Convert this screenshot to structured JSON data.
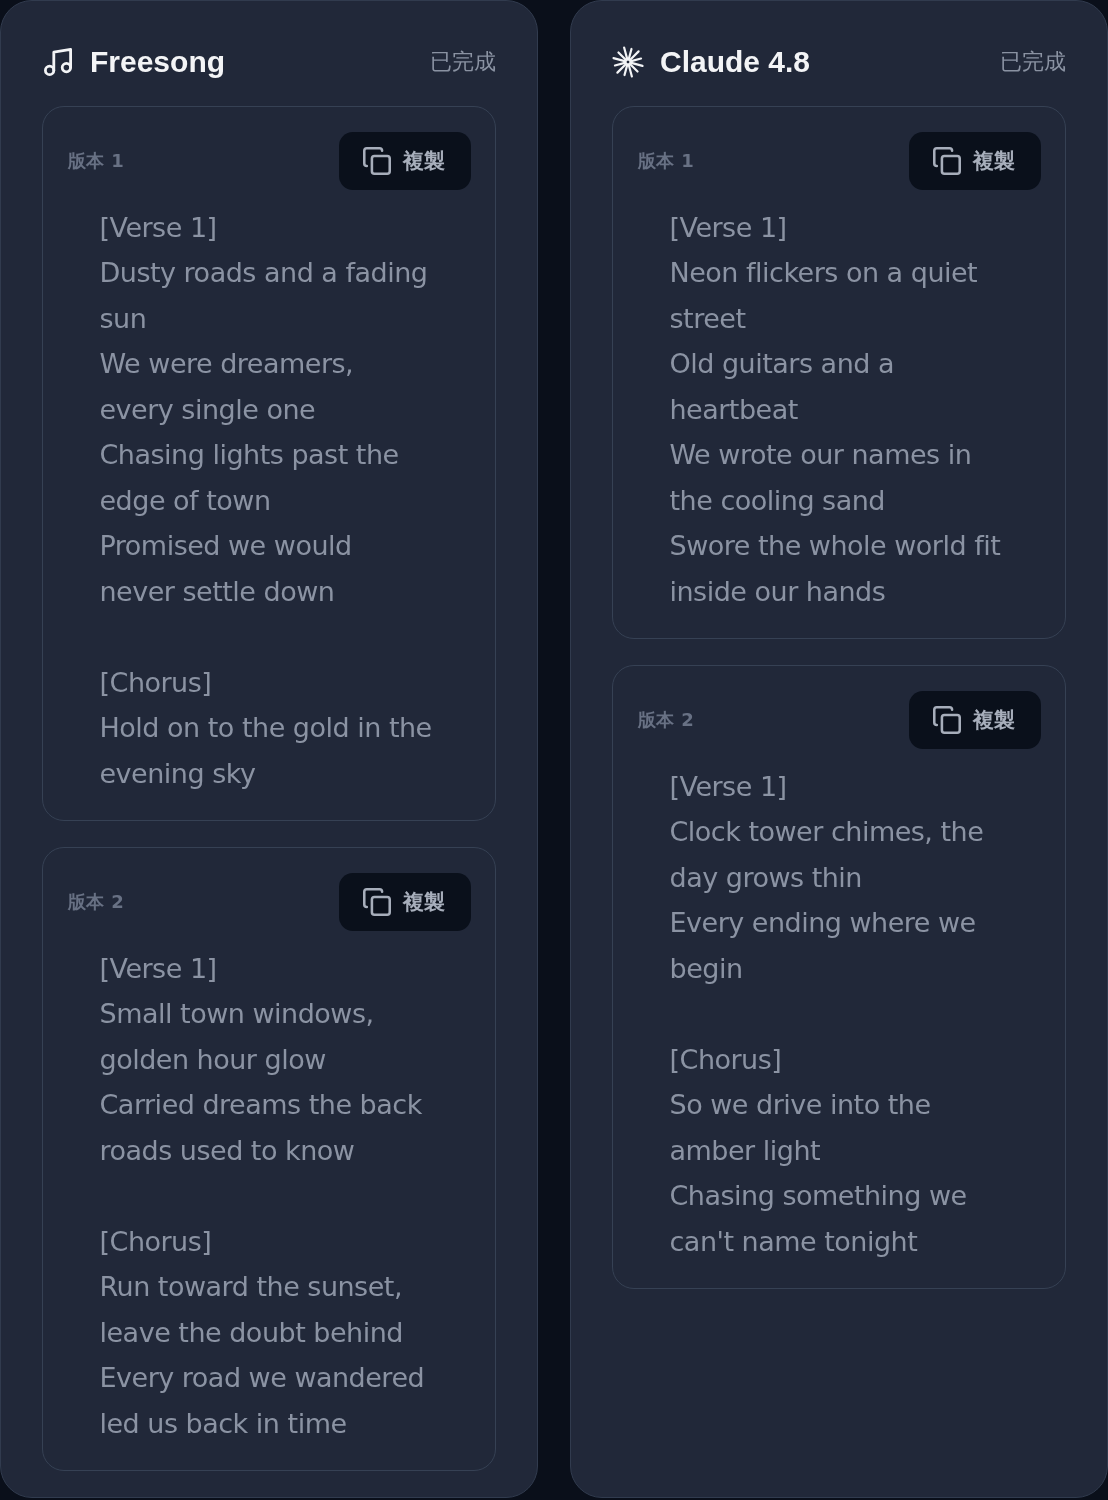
{
  "panels": [
    {
      "title": "Freesong",
      "status": "已完成",
      "versions": [
        {
          "label": "版本 1",
          "copy_button": "複製",
          "stanzas": [
            [
              "[Verse 1]",
              "Dusty roads and a fading sun",
              "We were dreamers, every single one",
              "Chasing lights past the edge of town",
              "Promised we would never settle down"
            ],
            [
              "[Chorus]",
              "Hold on to the gold in the evening sky"
            ]
          ]
        },
        {
          "label": "版本 2",
          "copy_button": "複製",
          "stanzas": [
            [
              "[Verse 1]",
              "Small town windows, golden hour glow",
              "Carried dreams the back roads used to know"
            ],
            [
              "[Chorus]",
              "Run toward the sunset, leave the doubt behind",
              "Every road we wandered led us back in time"
            ]
          ]
        }
      ]
    },
    {
      "title": "Claude 4.8",
      "status": "已完成",
      "versions": [
        {
          "label": "版本 1",
          "copy_button": "複製",
          "stanzas": [
            [
              "[Verse 1]",
              "Neon flickers on a quiet street",
              "Old guitars and a heartbeat",
              "We wrote our names in the cooling sand",
              "Swore the whole world fit inside our hands"
            ]
          ]
        },
        {
          "label": "版本 2",
          "copy_button": "複製",
          "stanzas": [
            [
              "[Verse 1]",
              "Clock tower chimes, the day grows thin",
              "Every ending where we begin"
            ],
            [
              "[Chorus]",
              "So we drive into the amber light",
              "Chasing something we can't name tonight"
            ]
          ]
        }
      ]
    }
  ]
}
